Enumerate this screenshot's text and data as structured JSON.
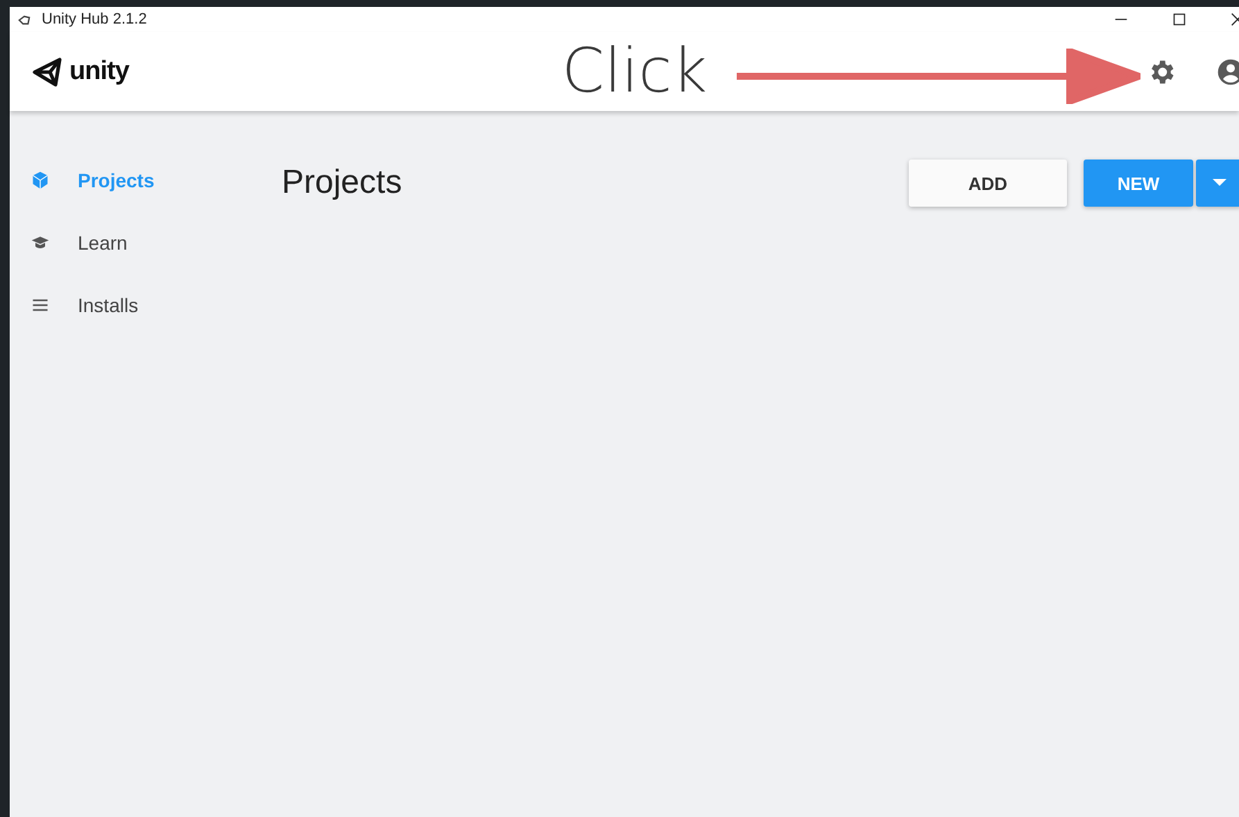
{
  "window": {
    "title": "Unity Hub 2.1.2"
  },
  "header": {
    "logo_text": "unity"
  },
  "annotation": {
    "text": "Click"
  },
  "sidebar": {
    "items": [
      {
        "label": "Projects",
        "kind": "projects",
        "selected": true
      },
      {
        "label": "Learn",
        "kind": "learn",
        "selected": false
      },
      {
        "label": "Installs",
        "kind": "installs",
        "selected": false
      }
    ]
  },
  "main": {
    "title": "Projects",
    "buttons": [
      {
        "label": "ADD",
        "kind": "secondary"
      },
      {
        "label": "NEW",
        "kind": "primary"
      }
    ]
  }
}
